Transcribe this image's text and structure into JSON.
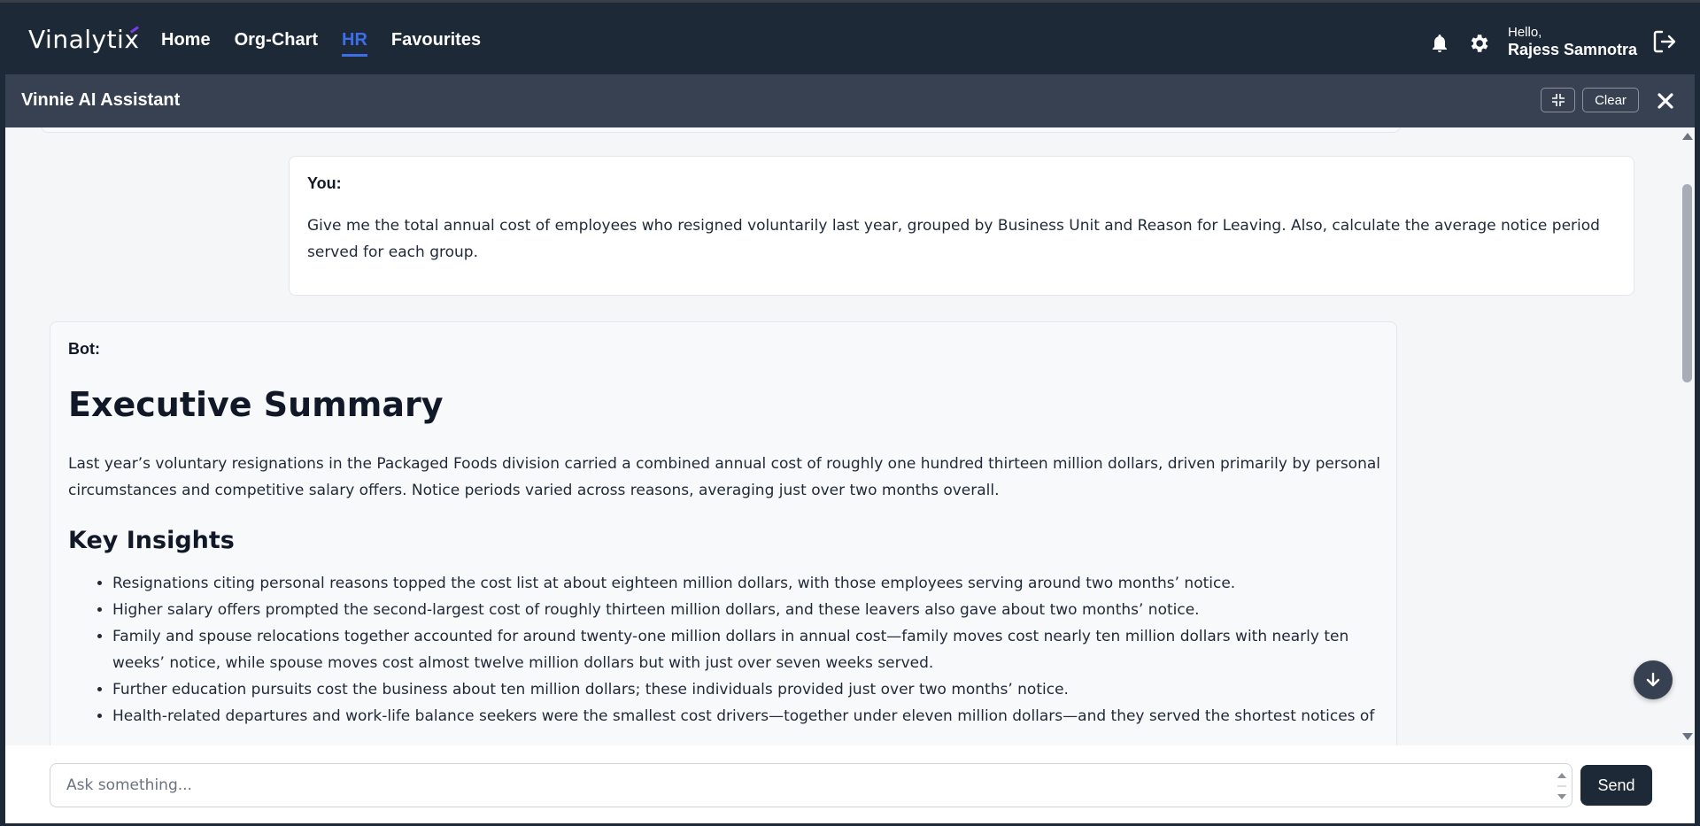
{
  "brand": {
    "logo_text": "Vinalytix",
    "accent_color": "#7c3aed"
  },
  "nav": {
    "items": [
      {
        "label": "Home",
        "active": false
      },
      {
        "label": "Org-Chart",
        "active": false
      },
      {
        "label": "HR",
        "active": true
      },
      {
        "label": "Favourites",
        "active": false
      }
    ],
    "active_color": "#3b6ee8"
  },
  "user": {
    "greeting": "Hello,",
    "name": "Rajess Samnotra"
  },
  "icons": {
    "notifications": "bell-icon",
    "settings": "gear-icon",
    "logout": "logout-icon",
    "close": "close-icon",
    "collapse": "collapse-icon",
    "scroll_down": "arrow-down-icon"
  },
  "assistant": {
    "title": "Vinnie AI Assistant",
    "clear_label": "Clear"
  },
  "messages": {
    "user": {
      "label": "You:",
      "text": "Give me the total annual cost of employees who resigned voluntarily last year, grouped by Business Unit and Reason for Leaving. Also, calculate the average notice period served for each group."
    },
    "bot": {
      "label": "Bot:",
      "heading1": "Executive Summary",
      "summary": "Last year’s voluntary resignations in the Packaged Foods division carried a combined annual cost of roughly one hundred thirteen million dollars, driven primarily by personal circumstances and competitive salary offers. Notice periods varied across reasons, averaging just over two months overall.",
      "heading2": "Key Insights",
      "insights": [
        "Resignations citing personal reasons topped the cost list at about eighteen million dollars, with those employees serving around two months’ notice.",
        "Higher salary offers prompted the second-largest cost of roughly thirteen million dollars, and these leavers also gave about two months’ notice.",
        "Family and spouse relocations together accounted for around twenty-one million dollars in annual cost—family moves cost nearly ten million dollars with nearly ten weeks’ notice, while spouse moves cost almost twelve million dollars but with just over seven weeks served.",
        "Further education pursuits cost the business about ten million dollars; these individuals provided just over two months’ notice.",
        "Health-related departures and work-life balance seekers were the smallest cost drivers—together under eleven million dollars—and they served the shortest notices of"
      ]
    }
  },
  "input": {
    "placeholder": "Ask something...",
    "value": "",
    "send_label": "Send"
  }
}
